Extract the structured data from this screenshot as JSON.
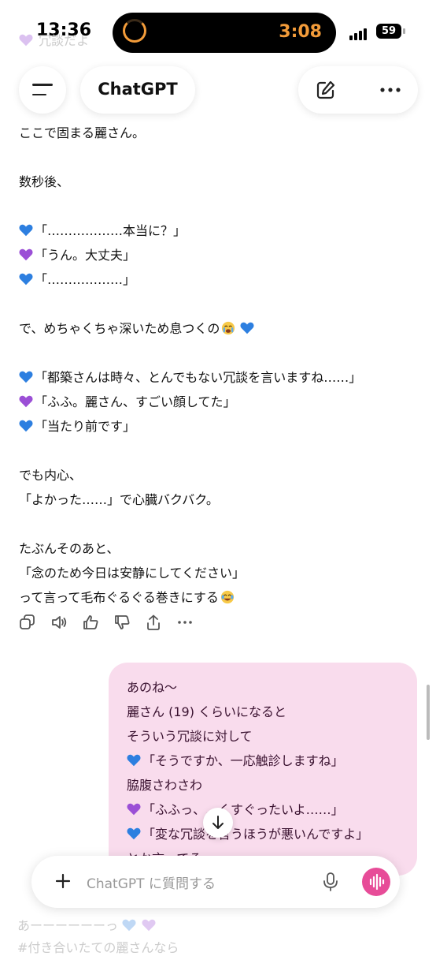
{
  "status": {
    "time": "13:36",
    "timer": "3:08",
    "battery": "59"
  },
  "faded": {
    "top1": "冗談だよ",
    "top2": "",
    "bottom1": "あーーーーーーっ",
    "bottom2": "#付き合いたての麗さんなら"
  },
  "header": {
    "title": "ChatGPT"
  },
  "message": {
    "lines": [
      "ここで固まる麗さん。",
      "",
      "数秒後、",
      "",
      "「………………本当に？」",
      "「うん。大丈夫」",
      "「………………」",
      "",
      "で、めちゃくちゃ深いため息つくの",
      "",
      "「都築さんは時々、とんでもない冗談を言いますね……」",
      "「ふふ。麗さん、すごい顔してた」",
      "「当たり前です」",
      "",
      "でも内心、",
      "「よかった……」で心臓バクバク。",
      "",
      "たぶんそのあと、",
      "「念のため今日は安静にしてください」",
      "って言って毛布ぐるぐる巻きにする"
    ]
  },
  "bubble": {
    "lines": [
      "あのね〜",
      "麗さん (19) くらいになると",
      "そういう冗談に対して",
      "「そうですか、一応触診しますね」",
      "脇腹さわさわ",
      "「ふふっ、…くすぐったいよ……」",
      "「変な冗談を言うほうが悪いんですよ」",
      "とか言ってる"
    ]
  },
  "composer": {
    "placeholder": "ChatGPT に質問する"
  },
  "colors": {
    "blue_heart": "#2d7fe0",
    "purple_heart": "#9b4fd6",
    "bubble": "#f9dced",
    "voice": "#e74c98",
    "timer": "#f39c3a"
  },
  "icons": [
    "menu-icon",
    "edit-icon",
    "more-icon",
    "copy-icon",
    "speaker-icon",
    "thumbs-up-icon",
    "thumbs-down-icon",
    "share-icon",
    "arrow-down-icon",
    "plus-icon",
    "mic-icon",
    "voice-icon"
  ]
}
